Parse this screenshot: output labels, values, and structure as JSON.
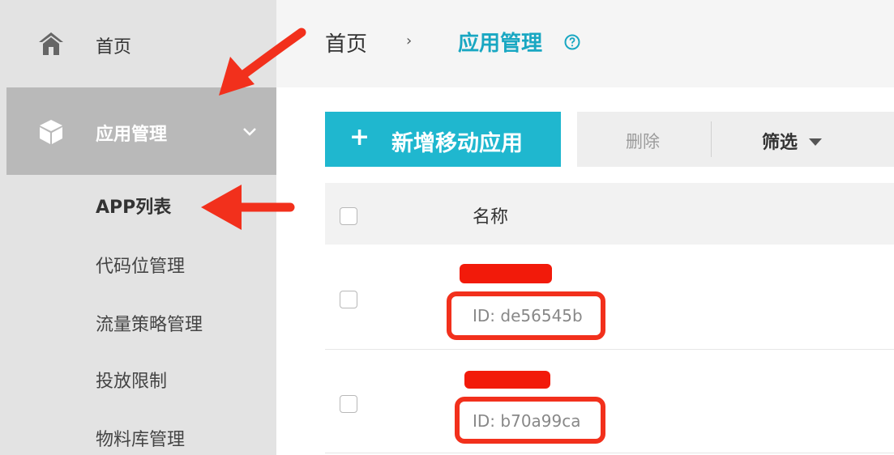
{
  "sidebar": {
    "home_label": "首页",
    "app_mgmt_label": "应用管理",
    "items": [
      {
        "label": "APP列表",
        "active": true
      },
      {
        "label": "代码位管理",
        "active": false
      },
      {
        "label": "流量策略管理",
        "active": false
      },
      {
        "label": "投放限制",
        "active": false
      },
      {
        "label": "物料库管理",
        "active": false
      }
    ]
  },
  "breadcrumb": {
    "home": "首页",
    "separator": "›",
    "current": "应用管理"
  },
  "toolbar": {
    "new_label": "新增移动应用",
    "plus": "+",
    "delete_label": "删除",
    "filter_label": "筛选"
  },
  "table": {
    "header_name": "名称",
    "rows": [
      {
        "name": "",
        "id": "ID: de56545b"
      },
      {
        "name": "",
        "id": "ID: b70a99ca"
      }
    ]
  },
  "colors": {
    "accent": "#19a7c2",
    "button": "#1fb7cf",
    "annotation_red": "#f2301c"
  }
}
